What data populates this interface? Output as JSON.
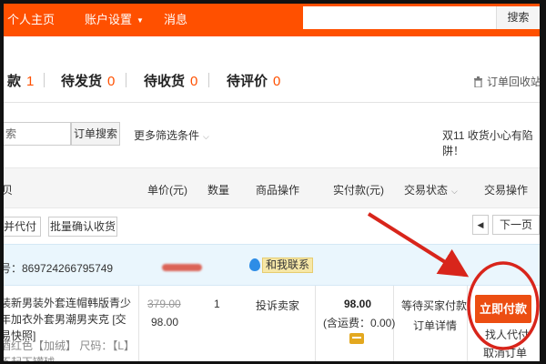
{
  "nav": {
    "home": "个人主页",
    "account": "账户设置",
    "messages": "消息",
    "search_button": "搜索",
    "search_value": ""
  },
  "status_tabs": [
    {
      "label": "款",
      "count": "1"
    },
    {
      "label": "待发货",
      "count": "0"
    },
    {
      "label": "待收货",
      "count": "0"
    },
    {
      "label": "待评价",
      "count": "0"
    }
  ],
  "recycle_bin": "订单回收站",
  "filters": {
    "search_value": "索",
    "search_button": "订单搜索",
    "more_filters": "更多筛选条件",
    "promo": "双11 收货小心有陷阱！"
  },
  "table_header": {
    "col_goods": "贝",
    "col_price": "单价(元)",
    "col_qty": "数量",
    "col_op": "商品操作",
    "col_paid": "实付款(元)",
    "col_status": "交易状态",
    "col_action": "交易操作"
  },
  "batch": {
    "merge_pay": "并代付",
    "confirm_receipt": "批量确认收货",
    "next_page": "下一页"
  },
  "order": {
    "order_no": "号：869724266795749",
    "contact_label": "和我联系",
    "item_title": "装新男装外套连帽韩版青少年加衣外套男潮男夹克 [交易快照]",
    "item_spec": "酒红色【加绒】 尺码：【L】不起下罐球",
    "orig_price": "379.00",
    "price": "98.00",
    "qty": "1",
    "item_op": "投诉卖家",
    "paid": "98.00",
    "shipping": "(含运费：0.00)",
    "status": "等待买家付款",
    "detail": "订单详情",
    "pay_now": "立即付款",
    "friend_pay": "找人代付",
    "cancel": "取消订单"
  },
  "colors": {
    "brand_orange": "#ff5000",
    "pay_button": "#ec4e12",
    "annotation_red": "#d8251b",
    "order_header_bg": "#eaf6fd"
  },
  "icons": [
    "caret-down-icon",
    "trash-icon",
    "chevron-down-icon",
    "chat-icon",
    "card-icon",
    "arrow-annotation",
    "circle-annotation"
  ]
}
